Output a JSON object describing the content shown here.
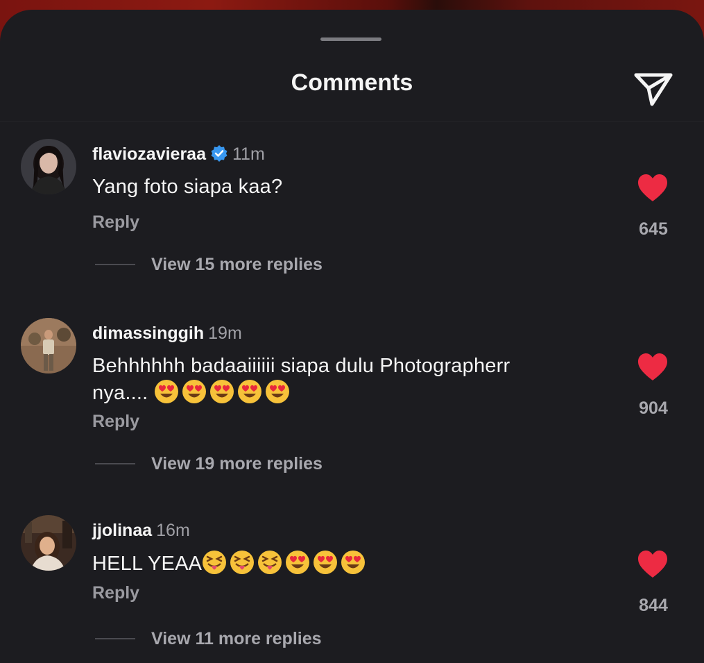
{
  "header": {
    "title": "Comments",
    "share_icon": "paper-plane-icon"
  },
  "colors": {
    "background": "#1c1c20",
    "text": "#f5f5f5",
    "secondary": "#a8a8ae",
    "like": "#ed2b43",
    "verified": "#3897f0"
  },
  "comments": [
    {
      "username": "flaviozavieraa",
      "verified": true,
      "time": "11m",
      "text": "Yang foto siapa kaa?",
      "emojis": [],
      "reply_label": "Reply",
      "likes": "645",
      "view_replies": "View 15 more replies"
    },
    {
      "username": "dimassinggih",
      "verified": false,
      "time": "19m",
      "text": "Behhhhhh badaaiiiiii siapa dulu Photographerr nya....",
      "emojis": [
        "heart-eyes",
        "heart-eyes",
        "heart-eyes",
        "heart-eyes",
        "heart-eyes"
      ],
      "reply_label": "Reply",
      "likes": "904",
      "view_replies": "View 19 more replies"
    },
    {
      "username": "jjolinaa",
      "verified": false,
      "time": "16m",
      "text": "HELL YEAA",
      "emojis": [
        "squinting-tongue",
        "squinting-tongue",
        "squinting-tongue",
        "heart-eyes",
        "heart-eyes",
        "heart-eyes"
      ],
      "reply_label": "Reply",
      "likes": "844",
      "view_replies": "View 11 more replies"
    }
  ]
}
